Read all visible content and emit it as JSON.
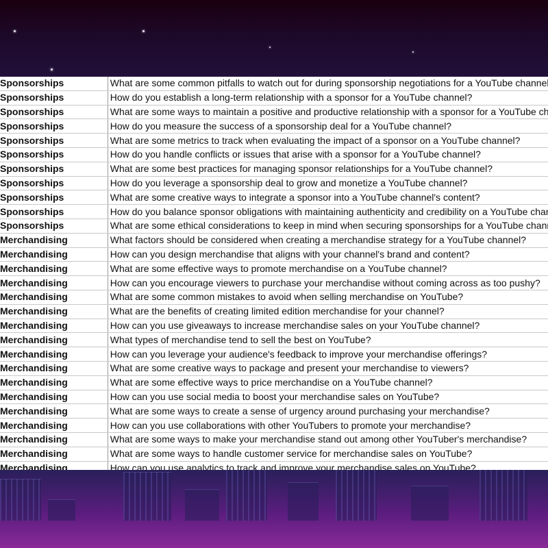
{
  "colors": {
    "sky_top": "#1a0010",
    "ground_bottom": "#8a2a98",
    "sheet_background": "#ffffff",
    "gridline": "#c8c8c8"
  },
  "spreadsheet": {
    "rows": [
      {
        "category": "Sponsorships",
        "question": "What are some common pitfalls to watch out for during sponsorship negotiations for a YouTube channel?"
      },
      {
        "category": "Sponsorships",
        "question": "How do you establish a long-term relationship with a sponsor for a YouTube channel?"
      },
      {
        "category": "Sponsorships",
        "question": "What are some ways to maintain a positive and productive relationship with a sponsor for a YouTube channel?"
      },
      {
        "category": "Sponsorships",
        "question": "How do you measure the success of a sponsorship deal for a YouTube channel?"
      },
      {
        "category": "Sponsorships",
        "question": "What are some metrics to track when evaluating the impact of a sponsor on a YouTube channel?"
      },
      {
        "category": "Sponsorships",
        "question": "How do you handle conflicts or issues that arise with a sponsor for a YouTube channel?"
      },
      {
        "category": "Sponsorships",
        "question": "What are some best practices for managing sponsor relationships for a YouTube channel?"
      },
      {
        "category": "Sponsorships",
        "question": "How do you leverage a sponsorship deal to grow and monetize a YouTube channel?"
      },
      {
        "category": "Sponsorships",
        "question": "What are some creative ways to integrate a sponsor into a YouTube channel's content?"
      },
      {
        "category": "Sponsorships",
        "question": "How do you balance sponsor obligations with maintaining authenticity and credibility on a YouTube channel?"
      },
      {
        "category": "Sponsorships",
        "question": "What are some ethical considerations to keep in mind when securing sponsorships for a YouTube channel?"
      },
      {
        "category": "Merchandising",
        "question": "What factors should be considered when creating a merchandise strategy for a YouTube channel?"
      },
      {
        "category": "Merchandising",
        "question": "How can you design merchandise that aligns with your channel's brand and content?"
      },
      {
        "category": "Merchandising",
        "question": "What are some effective ways to promote merchandise on a YouTube channel?"
      },
      {
        "category": "Merchandising",
        "question": "How can you encourage viewers to purchase your merchandise without coming across as too pushy?"
      },
      {
        "category": "Merchandising",
        "question": "What are some common mistakes to avoid when selling merchandise on YouTube?"
      },
      {
        "category": "Merchandising",
        "question": "What are the benefits of creating limited edition merchandise for your channel?"
      },
      {
        "category": "Merchandising",
        "question": "How can you use giveaways to increase merchandise sales on your YouTube channel?"
      },
      {
        "category": "Merchandising",
        "question": "What types of merchandise tend to sell the best on YouTube?"
      },
      {
        "category": "Merchandising",
        "question": "How can you leverage your audience's feedback to improve your merchandise offerings?"
      },
      {
        "category": "Merchandising",
        "question": "What are some creative ways to package and present your merchandise to viewers?"
      },
      {
        "category": "Merchandising",
        "question": "What are some effective ways to price merchandise on a YouTube channel?"
      },
      {
        "category": "Merchandising",
        "question": "How can you use social media to boost your merchandise sales on YouTube?"
      },
      {
        "category": "Merchandising",
        "question": "What are some ways to create a sense of urgency around purchasing your merchandise?"
      },
      {
        "category": "Merchandising",
        "question": "How can you use collaborations with other YouTubers to promote your merchandise?"
      },
      {
        "category": "Merchandising",
        "question": "What are some ways to make your merchandise stand out among other YouTuber's merchandise?"
      },
      {
        "category": "Merchandising",
        "question": "What are some ways to handle customer service for merchandise sales on YouTube?"
      },
      {
        "category": "Merchandising",
        "question": "How can you use analytics to track and improve your merchandise sales on YouTube?"
      }
    ]
  }
}
